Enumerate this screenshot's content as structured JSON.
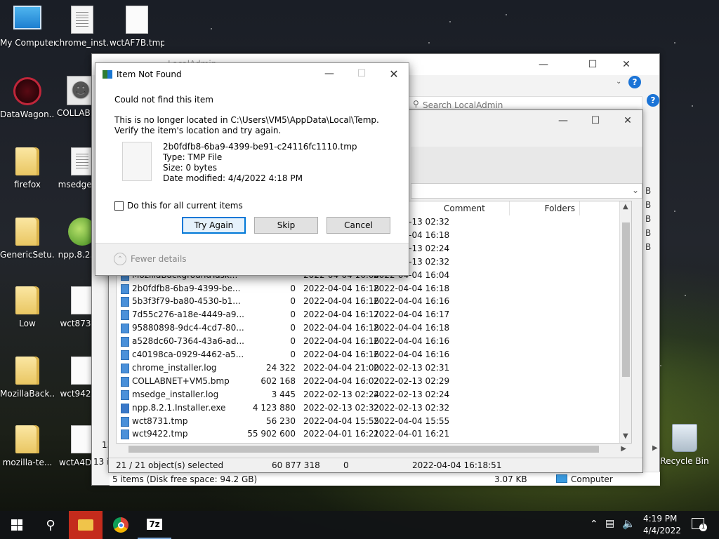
{
  "desktop": {
    "icons": [
      {
        "label": "My Computer"
      },
      {
        "label": "chrome_inst..."
      },
      {
        "label": "wctAF7B.tmp"
      },
      {
        "label": "DataWagon..."
      },
      {
        "label": "COLLABN..."
      },
      {
        "label": "firefox"
      },
      {
        "label": "msedge_i..."
      },
      {
        "label": "GenericSetu..."
      },
      {
        "label": "npp.8.2.1..."
      },
      {
        "label": "Low"
      },
      {
        "label": "wct8731..."
      },
      {
        "label": "MozillaBack..."
      },
      {
        "label": "wct9422..."
      },
      {
        "label": "mozilla-te..."
      },
      {
        "label": "wctA4DB..."
      },
      {
        "label": "Recycle Bin"
      }
    ]
  },
  "explorer_back": {
    "title": "LocalAdmin",
    "search_placeholder": "Search LocalAdmin",
    "left_count_a": "13 it",
    "left_count_b": "13 it",
    "status_left": "5 items (Disk free space: 94.2 GB)",
    "status_size": "3.07 KB",
    "status_location": "Computer",
    "side_letters": [
      "B",
      "B",
      "B",
      "B",
      "B"
    ]
  },
  "zip_window": {
    "columns": {
      "comment": "Comment",
      "folders": "Folders"
    },
    "rows": [
      {
        "name": "",
        "size": "",
        "modified": "",
        "created": "2022-02-13 02:32"
      },
      {
        "name": "",
        "size": "",
        "modified": "",
        "created": "2022-04-04 16:18"
      },
      {
        "name": "",
        "size": "",
        "modified": "",
        "created": "2022-02-13 02:24"
      },
      {
        "name": "",
        "size": "",
        "modified": "",
        "created": "2022-02-13 02:32"
      },
      {
        "name": "MozillaBackgroundTask...",
        "size": "",
        "modified": "2022-04-04 16:04",
        "created": "2022-04-04 16:04"
      },
      {
        "name": "2b0fdfb8-6ba9-4399-be...",
        "size": "0",
        "modified": "2022-04-04 16:18",
        "created": "2022-04-04 16:18"
      },
      {
        "name": "5b3f3f79-ba80-4530-b1...",
        "size": "0",
        "modified": "2022-04-04 16:16",
        "created": "2022-04-04 16:16"
      },
      {
        "name": "7d55c276-a18e-4449-a9...",
        "size": "0",
        "modified": "2022-04-04 16:17",
        "created": "2022-04-04 16:17"
      },
      {
        "name": "95880898-9dc4-4cd7-80...",
        "size": "0",
        "modified": "2022-04-04 16:18",
        "created": "2022-04-04 16:18"
      },
      {
        "name": "a528dc60-7364-43a6-ad...",
        "size": "0",
        "modified": "2022-04-04 16:16",
        "created": "2022-04-04 16:16"
      },
      {
        "name": "c40198ca-0929-4462-a5...",
        "size": "0",
        "modified": "2022-04-04 16:16",
        "created": "2022-04-04 16:16"
      },
      {
        "name": "chrome_installer.log",
        "size": "24 322",
        "modified": "2022-04-04 21:00",
        "created": "2022-02-13 02:31"
      },
      {
        "name": "COLLABNET+VM5.bmp",
        "size": "602 168",
        "modified": "2022-04-04 16:02",
        "created": "2022-02-13 02:29"
      },
      {
        "name": "msedge_installer.log",
        "size": "3 445",
        "modified": "2022-02-13 02:24",
        "created": "2022-02-13 02:24"
      },
      {
        "name": "npp.8.2.1.Installer.exe",
        "size": "4 123 880",
        "modified": "2022-02-13 02:32",
        "created": "2022-02-13 02:32"
      },
      {
        "name": "wct8731.tmp",
        "size": "56 230",
        "modified": "2022-04-04 15:55",
        "created": "2022-04-04 15:55"
      },
      {
        "name": "wct9422.tmp",
        "size": "55 902 600",
        "modified": "2022-04-01 16:21",
        "created": "2022-04-01 16:21"
      }
    ],
    "status": {
      "selected": "21 / 21 object(s) selected",
      "total_size": "60 877 318",
      "zero": "0",
      "datetime": "2022-04-04 16:18:51"
    }
  },
  "dialog": {
    "title": "Item Not Found",
    "heading": "Could not find this item",
    "message": "This is no longer located in C:\\Users\\VM5\\AppData\\Local\\Temp. Verify the item's location and try again.",
    "file_name": "2b0fdfb8-6ba9-4399-be91-c24116fc1110.tmp",
    "file_type": "Type: TMP File",
    "file_size": "Size: 0 bytes",
    "file_date": "Date modified: 4/4/2022 4:18 PM",
    "checkbox_label": "Do this for all current items",
    "buttons": {
      "try_again": "Try Again",
      "skip": "Skip",
      "cancel": "Cancel"
    },
    "fewer_details": "Fewer details"
  },
  "taskbar": {
    "time": "4:19 PM",
    "date": "4/4/2022",
    "notification_count": "1",
    "zip_label": "7z"
  }
}
